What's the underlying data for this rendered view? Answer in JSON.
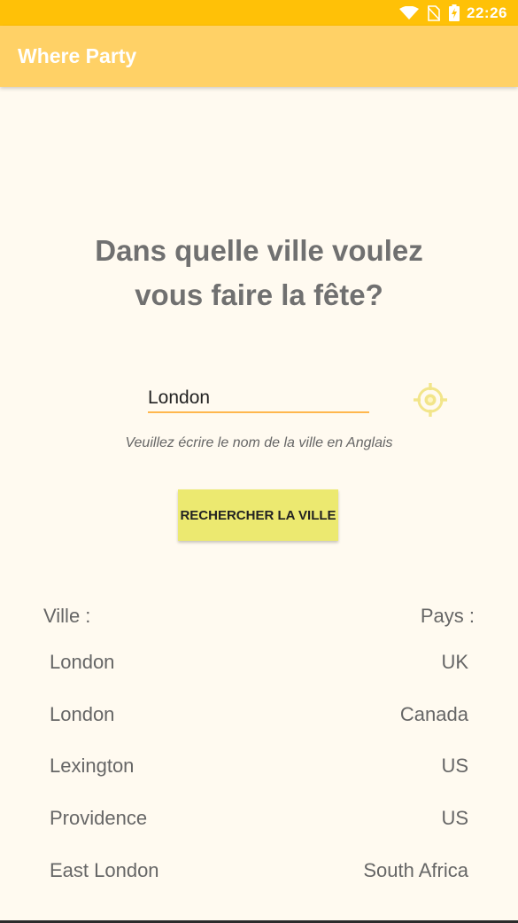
{
  "status_bar": {
    "time": "22:26",
    "icons": [
      "wifi-icon",
      "no-sim-icon",
      "battery-charging-icon"
    ]
  },
  "app_bar": {
    "title": "Where Party"
  },
  "main": {
    "question_line1": "Dans quelle ville voulez",
    "question_line2": "vous faire la fête?",
    "city_input_value": "London",
    "locate_icon": "gps-target-icon",
    "hint": "Veuillez écrire le nom de la ville en Anglais",
    "search_button_label": "RECHERCHER LA VILLE"
  },
  "results": {
    "city_header": "Ville :",
    "country_header": "Pays :",
    "rows": [
      {
        "city": "London",
        "country": "UK"
      },
      {
        "city": "London",
        "country": "Canada"
      },
      {
        "city": "Lexington",
        "country": "US"
      },
      {
        "city": "Providence",
        "country": "US"
      },
      {
        "city": "East London",
        "country": "South Africa"
      }
    ]
  },
  "colors": {
    "status_bar": "#ffc107",
    "app_bar": "#ffd166",
    "background": "#fffaf0",
    "input_underline": "#ffb74d",
    "search_button": "#ece970",
    "locate_icon": "#f2e58a"
  }
}
